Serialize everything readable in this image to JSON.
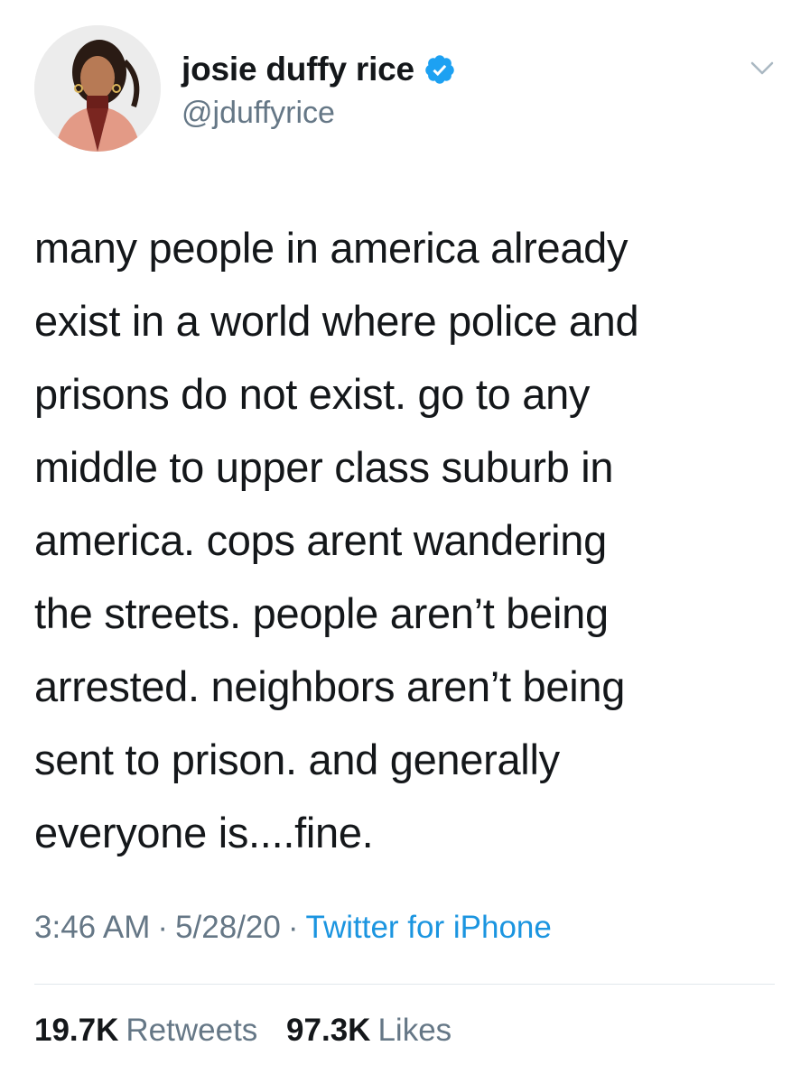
{
  "author": {
    "display_name": "josie duffy rice",
    "handle": "@jduffyrice",
    "verified": true,
    "avatar_icon": "profile-photo"
  },
  "tweet": {
    "text": "many people in america already\nexist in a world where police and\nprisons do not exist. go to any\nmiddle to upper class suburb in\namerica. cops arent wandering\nthe streets. people aren’t being\narrested. neighbors aren’t being\nsent to prison. and generally\neveryone is....fine.",
    "time": "3:46 AM",
    "date": "5/28/20",
    "separator": "·",
    "source": "Twitter for iPhone"
  },
  "stats": {
    "retweets_count": "19.7K",
    "retweets_label": "Retweets",
    "likes_count": "97.3K",
    "likes_label": "Likes"
  },
  "colors": {
    "text_primary": "#14171a",
    "text_secondary": "#657786",
    "link": "#1b95e0",
    "verified": "#1da1f2",
    "divider": "#e1e8ed"
  }
}
